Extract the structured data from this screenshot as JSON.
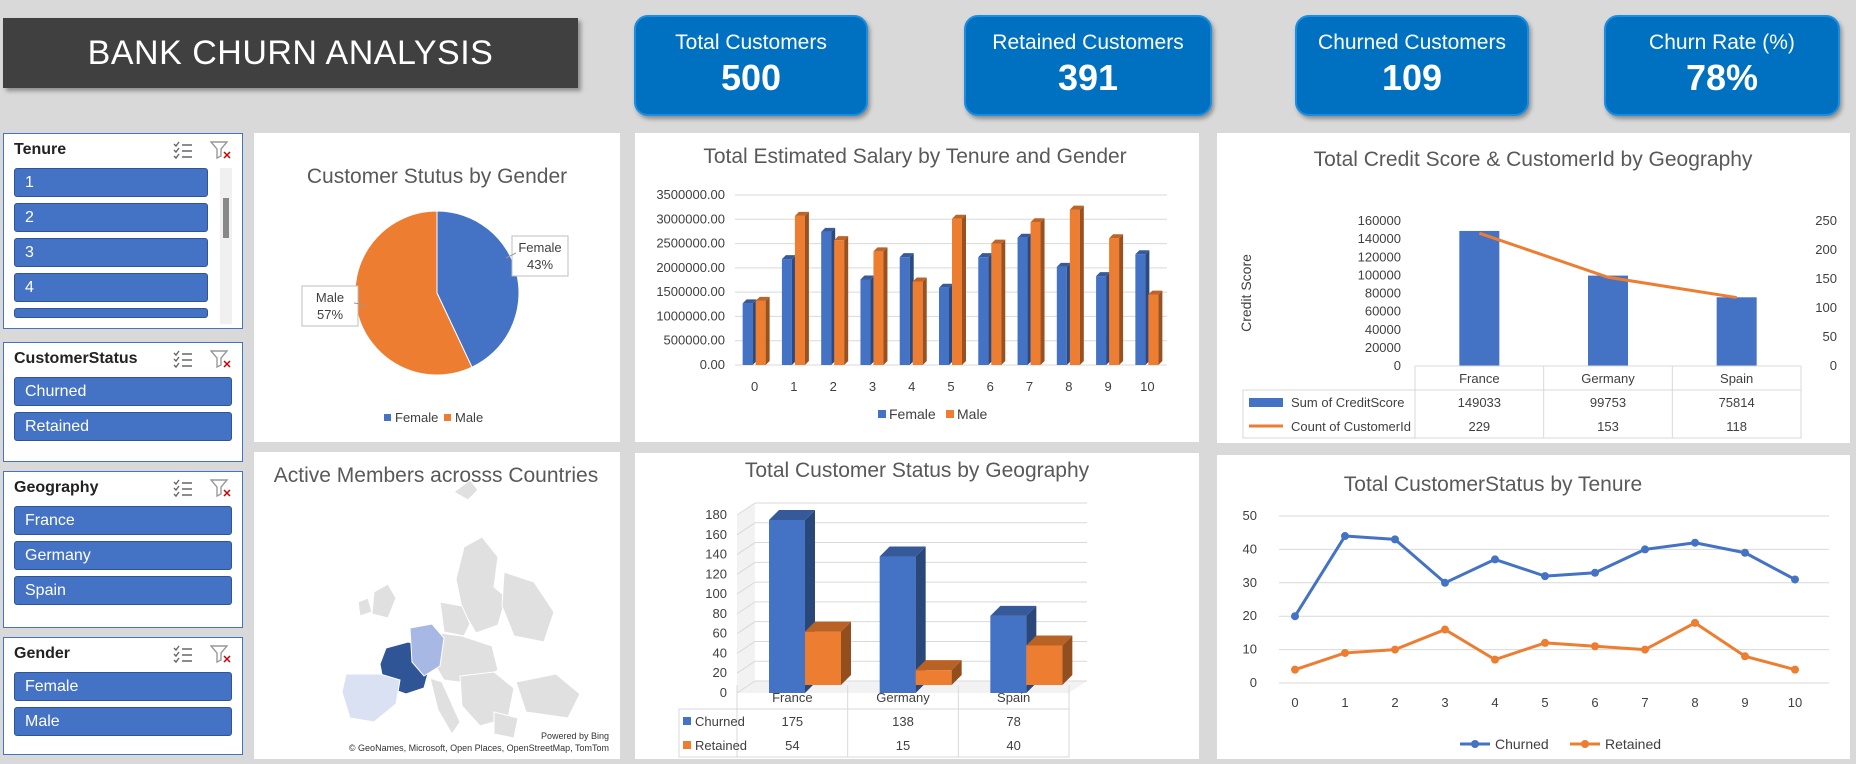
{
  "dashboard": {
    "title": "BANK CHURN ANALYSIS",
    "kpis": [
      {
        "label": "Total Customers",
        "value": "500"
      },
      {
        "label": "Retained Customers",
        "value": "391"
      },
      {
        "label": "Churned Customers",
        "value": "109"
      },
      {
        "label": "Churn Rate (%)",
        "value": "78%"
      }
    ]
  },
  "slicers": {
    "tenure": {
      "title": "Tenure",
      "items": [
        "1",
        "2",
        "3",
        "4"
      ]
    },
    "status": {
      "title": "CustomerStatus",
      "items": [
        "Churned",
        "Retained"
      ]
    },
    "geography": {
      "title": "Geography",
      "items": [
        "France",
        "Germany",
        "Spain"
      ]
    },
    "gender": {
      "title": "Gender",
      "items": [
        "Female",
        "Male"
      ]
    }
  },
  "colors": {
    "blue": "#4472c4",
    "orange": "#ed7d31",
    "kpi": "#0070c0",
    "title_bg": "#404040"
  },
  "map": {
    "title": "Active Members acrosss Countries",
    "powered": "Powered by Bing",
    "credits": "© GeoNames, Microsoft, Open Places, OpenStreetMap, TomTom"
  },
  "chart_data": [
    {
      "id": "gender_pie",
      "type": "pie",
      "title": "Customer Stutus by Gender",
      "categories": [
        "Female",
        "Male"
      ],
      "values": [
        43,
        57
      ],
      "labels": [
        {
          "name": "Female",
          "pct": "43%"
        },
        {
          "name": "Male",
          "pct": "57%"
        }
      ],
      "colors": [
        "#4472c4",
        "#ed7d31"
      ]
    },
    {
      "id": "salary_bar",
      "type": "bar",
      "title": "Total Estimated Salary by Tenure and Gender",
      "categories": [
        "0",
        "1",
        "2",
        "3",
        "4",
        "5",
        "6",
        "7",
        "8",
        "9",
        "10"
      ],
      "series": [
        {
          "name": "Female",
          "values": [
            1270000,
            2180000,
            2740000,
            1760000,
            2220000,
            1590000,
            2220000,
            2620000,
            2020000,
            1830000,
            2280000
          ]
        },
        {
          "name": "Male",
          "values": [
            1320000,
            3070000,
            2570000,
            2340000,
            1720000,
            3010000,
            2500000,
            2940000,
            3200000,
            2610000,
            1450000
          ]
        }
      ],
      "yticks": [
        "0.00",
        "500000.00",
        "1000000.00",
        "1500000.00",
        "2000000.00",
        "2500000.00",
        "3000000.00",
        "3500000.00"
      ],
      "ylim": [
        0,
        3500000
      ]
    },
    {
      "id": "credit_geo",
      "type": "bar",
      "title": "Total Credit Score & CustomerId by Geography",
      "ylabel": "Credit Score",
      "categories": [
        "France",
        "Germany",
        "Spain"
      ],
      "series": [
        {
          "name": "Sum of CreditScore",
          "values": [
            149033,
            99753,
            75814
          ]
        },
        {
          "name": "Count of CustomerId",
          "values": [
            229,
            153,
            118
          ]
        }
      ],
      "yticks_left": [
        "0",
        "20000",
        "40000",
        "60000",
        "80000",
        "100000",
        "120000",
        "140000",
        "160000"
      ],
      "yticks_right": [
        "0",
        "50",
        "100",
        "150",
        "200",
        "250"
      ],
      "ylim": [
        0,
        160000
      ],
      "y2lim": [
        0,
        250
      ]
    },
    {
      "id": "status_geo",
      "type": "bar",
      "title": "Total Customer Status by Geography",
      "categories": [
        "France",
        "Germany",
        "Spain"
      ],
      "series": [
        {
          "name": "Churned",
          "values": [
            175,
            138,
            78
          ]
        },
        {
          "name": "Retained",
          "values": [
            54,
            15,
            40
          ]
        }
      ],
      "yticks": [
        "0",
        "20",
        "40",
        "60",
        "80",
        "100",
        "120",
        "140",
        "160",
        "180"
      ],
      "ylim": [
        0,
        180
      ]
    },
    {
      "id": "status_tenure",
      "type": "line",
      "title": "Total CustomerStatus by Tenure",
      "categories": [
        "0",
        "1",
        "2",
        "3",
        "4",
        "5",
        "6",
        "7",
        "8",
        "9",
        "10"
      ],
      "series": [
        {
          "name": "Churned",
          "values": [
            20,
            44,
            43,
            30,
            37,
            32,
            33,
            40,
            42,
            39,
            31
          ]
        },
        {
          "name": "Retained",
          "values": [
            4,
            9,
            10,
            16,
            7,
            12,
            11,
            10,
            18,
            8,
            4
          ]
        }
      ],
      "yticks": [
        "0",
        "10",
        "20",
        "30",
        "40",
        "50"
      ],
      "ylim": [
        0,
        50
      ]
    }
  ]
}
